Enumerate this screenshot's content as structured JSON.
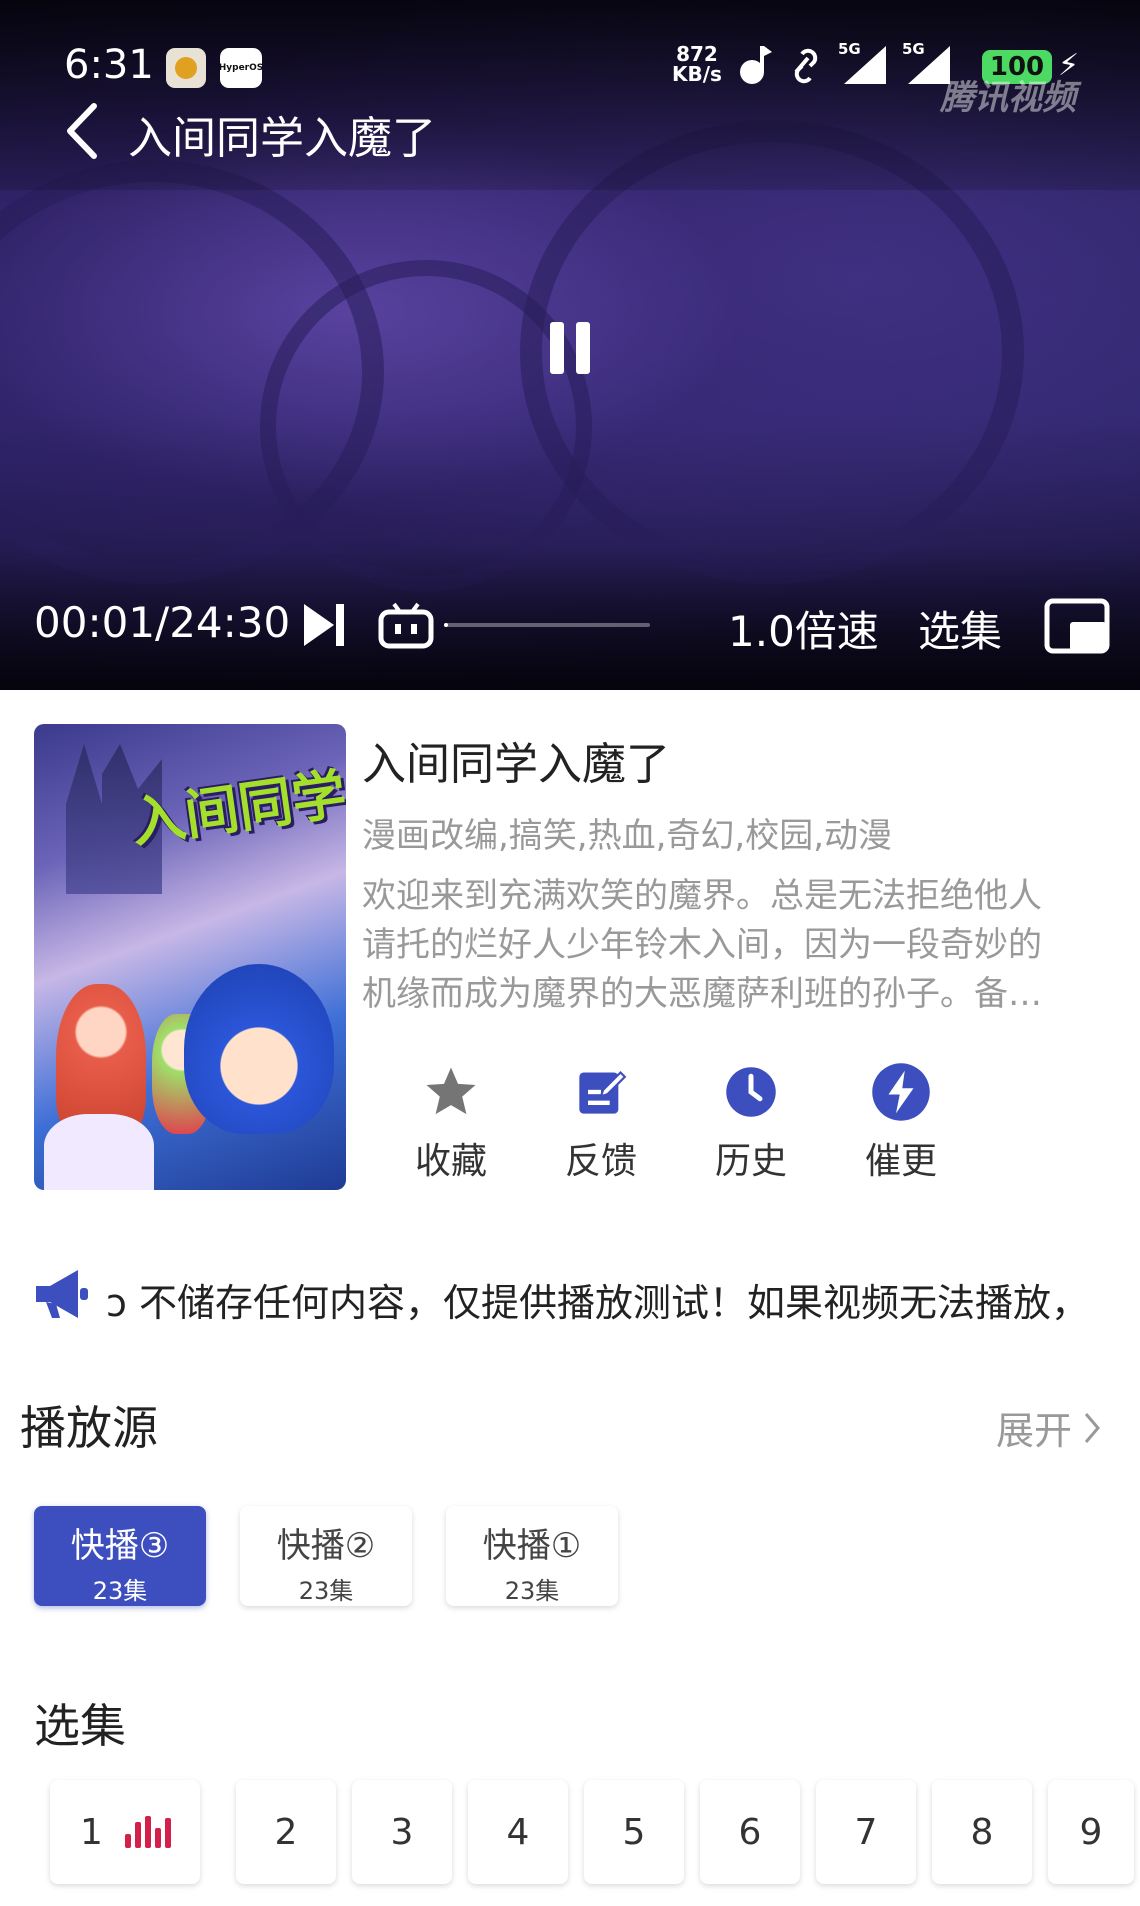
{
  "status_bar": {
    "time": "6:31",
    "app2_label": "HyperOS",
    "net_speed_value": "872",
    "net_speed_unit": "KB/s",
    "signal1_label": "5G",
    "signal2_label": "5G",
    "battery": "100"
  },
  "player": {
    "brand_watermark": "腾讯视频",
    "title": "入间同学入魔了",
    "time_display": "00:01/24:30",
    "progress": 0.0007,
    "speed_label": "1.0倍速",
    "episodes_label": "选集",
    "colors": {
      "accent": "#3d4fbe",
      "playing": "#d3204a"
    }
  },
  "show": {
    "title": "入间同学入魔了",
    "tags": "漫画改编,搞笑,热血,奇幻,校园,动漫",
    "description_lines": [
      "欢迎来到充满欢笑的魔界。总是无法拒绝他人",
      "请托的烂好人少年铃木入间，因为一段奇妙的",
      "机缘而成为魔界的大恶魔萨利班的孙子。备…"
    ],
    "poster_logo_text": "入间同学"
  },
  "actions": [
    {
      "label": "收藏",
      "icon": "star-icon"
    },
    {
      "label": "反馈",
      "icon": "feedback-icon"
    },
    {
      "label": "历史",
      "icon": "clock-icon"
    },
    {
      "label": "催更",
      "icon": "bolt-icon"
    }
  ],
  "notice": {
    "text": "ɔ 不储存任何内容，仅提供播放测试！如果视频无法播放，"
  },
  "sources": {
    "title": "播放源",
    "expand_label": "展开",
    "items": [
      {
        "name": "快播③",
        "count": "23集",
        "active": true
      },
      {
        "name": "快播②",
        "count": "23集",
        "active": false
      },
      {
        "name": "快播①",
        "count": "23集",
        "active": false
      }
    ]
  },
  "episodes": {
    "title": "选集",
    "items": [
      "1",
      "2",
      "3",
      "4",
      "5",
      "6",
      "7",
      "8",
      "9"
    ]
  }
}
